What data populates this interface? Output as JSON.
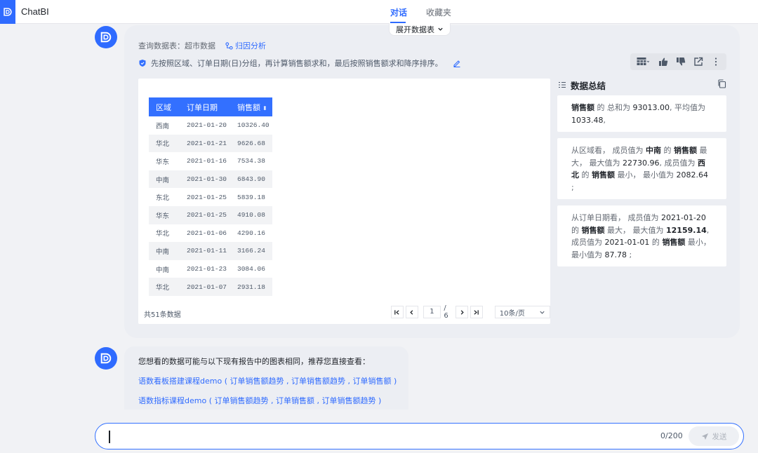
{
  "app": {
    "title": "ChatBI",
    "accent": "#2f6bff"
  },
  "top_tabs": [
    {
      "label": "对话",
      "active": true
    },
    {
      "label": "收藏夹",
      "active": false
    }
  ],
  "expand_label": "展开数据表",
  "answer": {
    "query_prefix": "查询数据表：",
    "query_table": "超市数据",
    "attribution_label": "归因分析",
    "plan_text": "先按照区域、订单日期(日)分组，再计算销售额求和，最后按照销售额求和降序排序。"
  },
  "table": {
    "columns": [
      "区域",
      "订单日期",
      "销售额"
    ],
    "rows": [
      [
        "西南",
        "2021-01-20",
        "10326.40"
      ],
      [
        "华北",
        "2021-01-21",
        "9626.68"
      ],
      [
        "华东",
        "2021-01-16",
        "7534.38"
      ],
      [
        "中南",
        "2021-01-30",
        "6843.90"
      ],
      [
        "东北",
        "2021-01-25",
        "5839.18"
      ],
      [
        "华东",
        "2021-01-25",
        "4910.08"
      ],
      [
        "华北",
        "2021-01-06",
        "4290.16"
      ],
      [
        "中南",
        "2021-01-11",
        "3166.24"
      ],
      [
        "中南",
        "2021-01-23",
        "3084.06"
      ],
      [
        "华北",
        "2021-01-07",
        "2931.18"
      ]
    ],
    "total_label": "共51条数据",
    "page": "1",
    "page_total": "/ 6",
    "page_size": "10条/页"
  },
  "summary": {
    "title": "数据总结",
    "card1": {
      "m1": "销售额",
      "t1": " 的 总和为 ",
      "v1": "93013.00",
      "t2": ",   平均值为 ",
      "v2": "1033.48",
      "t3": ","
    },
    "card2": {
      "t1": "从区域看， 成员值为 ",
      "v1": "中南",
      "t2": " 的 ",
      "m1": "销售额",
      "t3": " 最大， 最大值为 ",
      "v2": "22730.96",
      "t4": ",   成员值为 ",
      "v3": "西北",
      "t5": " 的 ",
      "m2": "销售额",
      "t6": " 最小， 最小值为 ",
      "v4": "2082.64",
      "t7": " ;"
    },
    "card3": {
      "t1": "从订单日期看， 成员值为 ",
      "v1": "2021-01-20",
      "t2": " 的 ",
      "m1": "销售额",
      "t3": " 最大， 最大值为 ",
      "v2": "12159.14",
      "t4": ",   成员值为 ",
      "v3": "2021-01-01",
      "t5": " 的 ",
      "m2": "销售额",
      "t6": " 最小， 最小值为 ",
      "v4": "87.78",
      "t7": " ;"
    }
  },
  "recommend": {
    "intro": "您想看的数据可能与以下现有报告中的图表相同，推荐您直接查看：",
    "items": [
      {
        "report": "语数看板搭建课程demo",
        "charts": "( 订单销售额趋势 , 订单销售额趋势 , 订单销售额 )"
      },
      {
        "report": "语数指标课程demo",
        "charts": "( 订单销售额趋势 , 订单销售额 , 订单销售额趋势 )"
      }
    ]
  },
  "input": {
    "counter": "0/200",
    "send_label": "发送"
  }
}
